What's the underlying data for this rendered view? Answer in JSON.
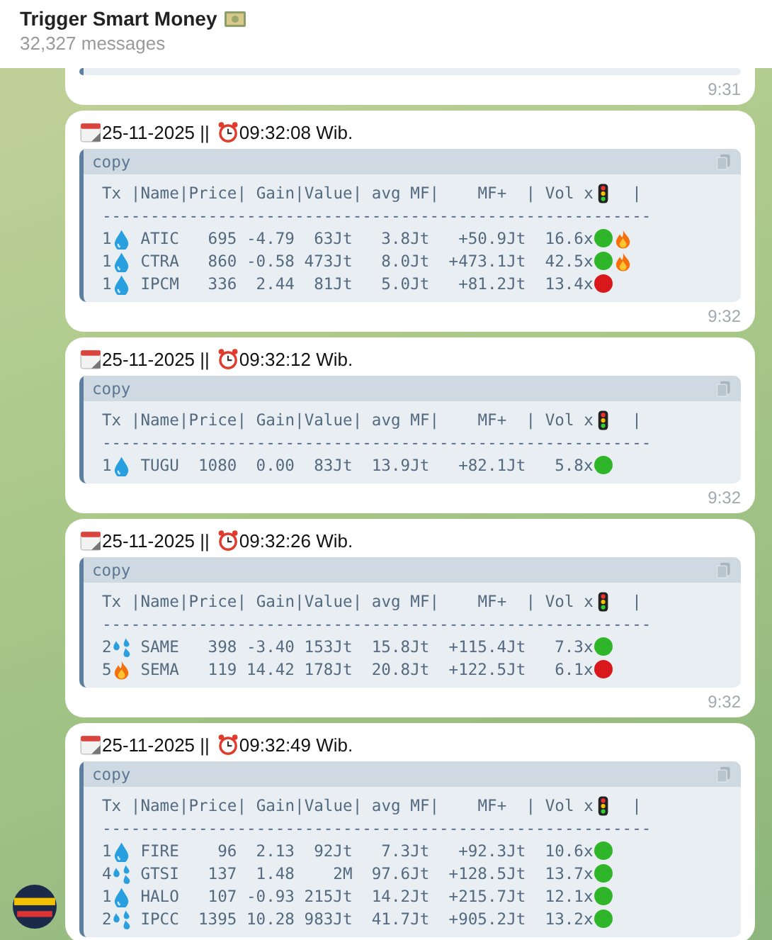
{
  "chat": {
    "title": "Trigger Smart Money",
    "subtitle": "32,327 messages"
  },
  "partial_message": {
    "time": "9:31"
  },
  "messages": [
    {
      "date": "25-11-2025 ||",
      "clock": "09:32:08 Wib.",
      "copy_label": "copy",
      "header": "Tx |Name|Price| Gain|Value| avg MF|    MF+  | Vol x",
      "header_end": "|",
      "divider": "---------------------------------------------------------",
      "time": "9:32",
      "rows": [
        {
          "tx": "1",
          "kind": "drop",
          "name": "ATIC",
          "price": "695",
          "gain": "-4.79",
          "value": "63Jt",
          "avg_mf": "3.8Jt",
          "mf_plus": "+50.9Jt",
          "vol": "16.6x",
          "color": "#2fb52a",
          "hot": true
        },
        {
          "tx": "1",
          "kind": "drop",
          "name": "CTRA",
          "price": "860",
          "gain": "-0.58",
          "value": "473Jt",
          "avg_mf": "8.0Jt",
          "mf_plus": "+473.1Jt",
          "vol": "42.5x",
          "color": "#2fb52a",
          "hot": true
        },
        {
          "tx": "1",
          "kind": "drop",
          "name": "IPCM",
          "price": "336",
          "gain": "2.44",
          "value": "81Jt",
          "avg_mf": "5.0Jt",
          "mf_plus": "+81.2Jt",
          "vol": "13.4x",
          "color": "#d8181a",
          "hot": false
        }
      ]
    },
    {
      "date": "25-11-2025 ||",
      "clock": "09:32:12 Wib.",
      "copy_label": "copy",
      "header": "Tx |Name|Price| Gain|Value| avg MF|    MF+  | Vol x",
      "header_end": "|",
      "divider": "---------------------------------------------------------",
      "time": "9:32",
      "rows": [
        {
          "tx": "1",
          "kind": "drop",
          "name": "TUGU",
          "price": "1080",
          "gain": "0.00",
          "value": "83Jt",
          "avg_mf": "13.9Jt",
          "mf_plus": "+82.1Jt",
          "vol": "5.8x",
          "color": "#2fb52a",
          "hot": false
        }
      ]
    },
    {
      "date": "25-11-2025 ||",
      "clock": "09:32:26 Wib.",
      "copy_label": "copy",
      "header": "Tx |Name|Price| Gain|Value| avg MF|    MF+  | Vol x",
      "header_end": "|",
      "divider": "---------------------------------------------------------",
      "time": "9:32",
      "rows": [
        {
          "tx": "2",
          "kind": "splash",
          "name": "SAME",
          "price": "398",
          "gain": "-3.40",
          "value": "153Jt",
          "avg_mf": "15.8Jt",
          "mf_plus": "+115.4Jt",
          "vol": "7.3x",
          "color": "#2fb52a",
          "hot": false
        },
        {
          "tx": "5",
          "kind": "fire",
          "name": "SEMA",
          "price": "119",
          "gain": "14.42",
          "value": "178Jt",
          "avg_mf": "20.8Jt",
          "mf_plus": "+122.5Jt",
          "vol": "6.1x",
          "color": "#d8181a",
          "hot": false
        }
      ]
    },
    {
      "date": "25-11-2025 ||",
      "clock": "09:32:49 Wib.",
      "copy_label": "copy",
      "header": "Tx |Name|Price| Gain|Value| avg MF|    MF+  | Vol x",
      "header_end": "|",
      "divider": "---------------------------------------------------------",
      "rows": [
        {
          "tx": "1",
          "kind": "drop",
          "name": "FIRE",
          "price": "96",
          "gain": "2.13",
          "value": "92Jt",
          "avg_mf": "7.3Jt",
          "mf_plus": "+92.3Jt",
          "vol": "10.6x",
          "color": "#2fb52a",
          "hot": false
        },
        {
          "tx": "4",
          "kind": "splash",
          "name": "GTSI",
          "price": "137",
          "gain": "1.48",
          "value": "2M",
          "avg_mf": "97.6Jt",
          "mf_plus": "+128.5Jt",
          "vol": "13.7x",
          "color": "#2fb52a",
          "hot": false
        },
        {
          "tx": "1",
          "kind": "drop",
          "name": "HALO",
          "price": "107",
          "gain": "-0.93",
          "value": "215Jt",
          "avg_mf": "14.2Jt",
          "mf_plus": "+215.7Jt",
          "vol": "12.1x",
          "color": "#2fb52a",
          "hot": false
        },
        {
          "tx": "2",
          "kind": "splash",
          "name": "IPCC",
          "price": "1395",
          "gain": "10.28",
          "value": "983Jt",
          "avg_mf": "41.7Jt",
          "mf_plus": "+905.2Jt",
          "vol": "13.2x",
          "color": "#2fb52a",
          "hot": false
        }
      ]
    }
  ]
}
